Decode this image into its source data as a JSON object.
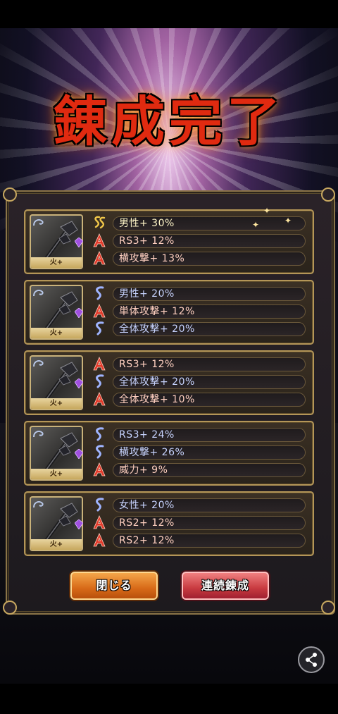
{
  "title": "錬成完了",
  "items": [
    {
      "rank_label": "火+",
      "stats": [
        {
          "tier": "SS",
          "text": "男性+ 30%"
        },
        {
          "tier": "A",
          "text": "RS3+ 12%"
        },
        {
          "tier": "A",
          "text": "横攻撃+ 13%"
        }
      ]
    },
    {
      "rank_label": "火+",
      "stats": [
        {
          "tier": "S",
          "text": "男性+ 20%"
        },
        {
          "tier": "A",
          "text": "単体攻撃+ 12%"
        },
        {
          "tier": "S",
          "text": "全体攻撃+ 20%"
        }
      ]
    },
    {
      "rank_label": "火+",
      "stats": [
        {
          "tier": "A",
          "text": "RS3+ 12%"
        },
        {
          "tier": "S",
          "text": "全体攻撃+ 20%"
        },
        {
          "tier": "A",
          "text": "全体攻撃+ 10%"
        }
      ]
    },
    {
      "rank_label": "火+",
      "stats": [
        {
          "tier": "S",
          "text": "RS3+ 24%"
        },
        {
          "tier": "S",
          "text": "横攻撃+ 26%"
        },
        {
          "tier": "A",
          "text": "威力+ 9%"
        }
      ]
    },
    {
      "rank_label": "火+",
      "stats": [
        {
          "tier": "S",
          "text": "女性+ 20%"
        },
        {
          "tier": "A",
          "text": "RS2+ 12%"
        },
        {
          "tier": "A",
          "text": "RS2+ 12%"
        }
      ]
    }
  ],
  "buttons": {
    "close": "閉じる",
    "again": "連続錬成"
  },
  "icons": {
    "share": "share-icon",
    "weapon": "axe-icon",
    "gem": "purple-gem-icon"
  },
  "colors": {
    "tier_a": "#e23a2a",
    "tier_s": "#9fb4ff",
    "tier_ss": "#f2c84a",
    "frame": "#b49658"
  }
}
